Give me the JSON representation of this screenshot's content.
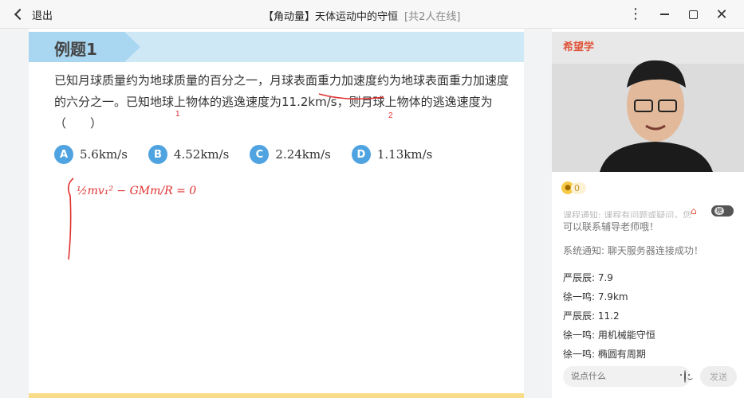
{
  "topbar": {
    "back_label": "退出",
    "title": "【角动量】天体运动中的守恒",
    "online": "[共2人在线]"
  },
  "slide": {
    "title": "例题1",
    "question": "已知月球质量约为地球质量的百分之一，月球表面重力加速度约为地球表面重力加速度的六分之一。已知地球上物体的逃逸速度为11.2km/s，则月球上物体的逃逸速度为（　　）",
    "options": [
      {
        "letter": "A",
        "text": "5.6km/s"
      },
      {
        "letter": "B",
        "text": "4.52km/s"
      },
      {
        "letter": "C",
        "text": "2.24km/s"
      },
      {
        "letter": "D",
        "text": "1.13km/s"
      }
    ],
    "ink_marks": {
      "mark1": "1",
      "mark2": "2"
    },
    "handwriting": "½mv₁² − GMm/R = 0"
  },
  "side": {
    "logo": "希望学",
    "coin_count": "0",
    "toggle_label": "榜",
    "messages": {
      "sys_cut": "课程通知: 课程有问题或疑问，您",
      "sys1": "可以联系辅导老师哦！",
      "sys2": "系统通知: 聊天服务器连接成功！",
      "u1": "严辰辰: 7.9",
      "u2": "徐一鸣: 7.9km",
      "u3": "严辰辰: 11.2",
      "u4": "徐一鸣: 用机械能守恒",
      "u5": "徐一鸣: 椭圆有周期"
    },
    "input_placeholder": "说点什么",
    "send_label": "发送"
  },
  "colors": {
    "accent": "#4fa3e0",
    "ink": "#e03030",
    "brand": "#e0563c"
  }
}
